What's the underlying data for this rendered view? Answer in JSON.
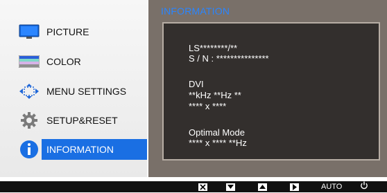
{
  "menu": {
    "items": [
      {
        "label": "PICTURE",
        "icon": "monitor-icon"
      },
      {
        "label": "COLOR",
        "icon": "color-bars-icon"
      },
      {
        "label": "MENU SETTINGS",
        "icon": "menu-settings-arrows-icon"
      },
      {
        "label": "SETUP&RESET",
        "icon": "gear-icon"
      },
      {
        "label": "INFORMATION",
        "icon": "info-icon",
        "selected": true
      }
    ]
  },
  "info": {
    "title": "INFORMATION",
    "model": "LS********/**",
    "serial": "S / N : ***************",
    "input_source": "DVI",
    "frequency": "**kHz **Hz **",
    "resolution": "**** x ****",
    "optimal_mode_label": "Optimal Mode",
    "optimal_mode_value": "**** x **** **Hz"
  },
  "bottom_bar": {
    "buttons": [
      {
        "name": "close-button",
        "icon": "close-icon"
      },
      {
        "name": "down-button",
        "icon": "triangle-down-icon"
      },
      {
        "name": "up-button",
        "icon": "triangle-up-icon"
      },
      {
        "name": "enter-button",
        "icon": "triangle-right-icon"
      },
      {
        "name": "auto-button",
        "label": "AUTO"
      },
      {
        "name": "power-button",
        "icon": "power-icon"
      }
    ]
  },
  "colors": {
    "accent": "#1a6fe3",
    "title": "#2a85ff",
    "panel": "#797069",
    "info_box": "#332f2d"
  }
}
